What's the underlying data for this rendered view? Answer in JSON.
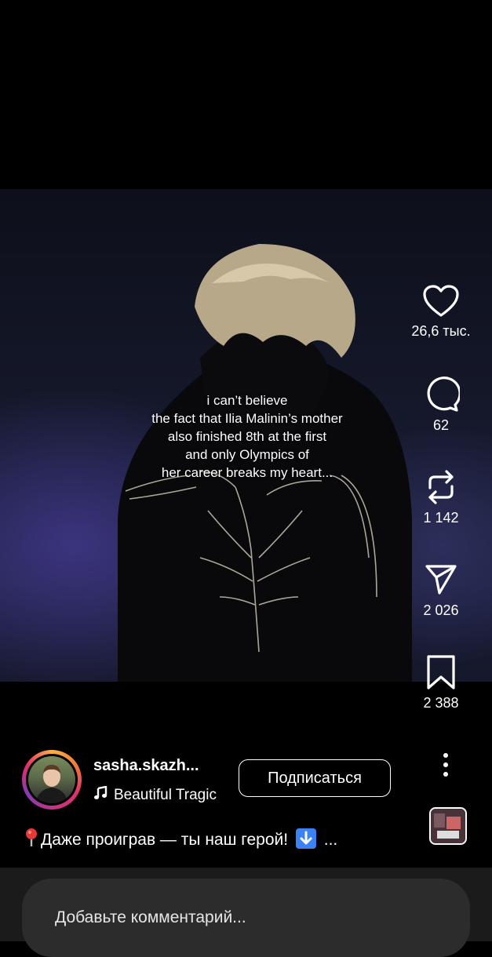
{
  "video": {
    "overlay_lines": [
      "i can’t believe",
      "the fact that Ilia Malinin’s mother",
      "also finished 8th at the first",
      "and only Olympics of",
      "her career breaks my heart..."
    ]
  },
  "actions": {
    "likes": "26,6 тыс.",
    "comments": "62",
    "reposts": "1 142",
    "shares": "2 026",
    "saves": "2 388"
  },
  "post": {
    "username": "sasha.skazh...",
    "music_title": "Beautiful Tragic",
    "follow_label": "Подписаться",
    "caption_text": "Даже проиграв — ты наш герой!",
    "caption_more": "..."
  },
  "comment": {
    "placeholder": "Добавьте комментарий..."
  },
  "icons": [
    "heart-icon",
    "comment-icon",
    "repost-icon",
    "share-icon",
    "bookmark-icon",
    "more-icon",
    "music-note-icon",
    "pin-icon",
    "down-arrow-icon"
  ],
  "colors": {
    "background": "#000000",
    "comment_bar": "#1b1b1b",
    "comment_input": "#2c2c2c",
    "accent_blue": "#3b82f6"
  }
}
